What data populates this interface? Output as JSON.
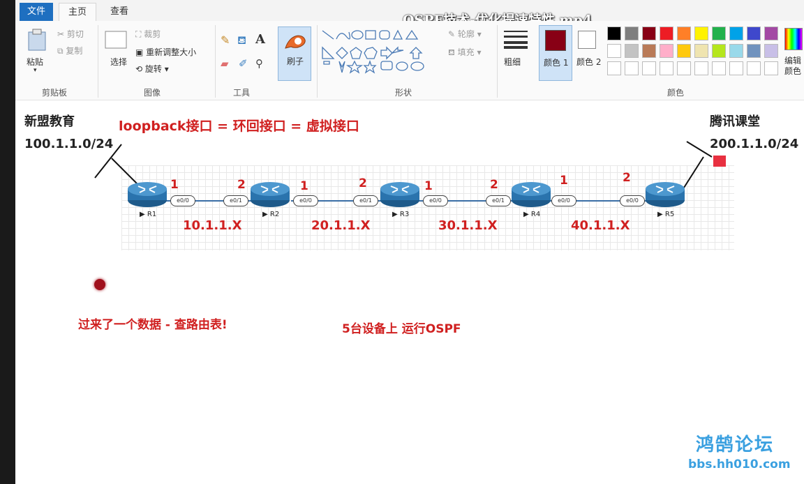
{
  "window": {
    "video_title": "OSPF技术-优化提速特性.mp4"
  },
  "tabs": [
    {
      "label": "文件"
    },
    {
      "label": "主页"
    },
    {
      "label": "查看"
    }
  ],
  "ribbon": {
    "clipboard": {
      "paste": "粘贴",
      "cut": "剪切",
      "copy": "复制",
      "group": "剪贴板"
    },
    "image": {
      "select": "选择",
      "crop": "裁剪",
      "resize": "重新调整大小",
      "rotate": "旋转",
      "group": "图像"
    },
    "tools": {
      "group": "工具"
    },
    "brush": {
      "label": "刷子"
    },
    "shapes": {
      "outline": "轮廓",
      "fill": "填充",
      "group": "形状"
    },
    "size": {
      "label": "粗细"
    },
    "color1": {
      "label": "颜色 1"
    },
    "color2": {
      "label": "颜色 2"
    },
    "colors": {
      "group": "颜色",
      "edit": "编辑颜色"
    },
    "palette": [
      "#000000",
      "#7f7f7f",
      "#880015",
      "#ed1c24",
      "#ff7f27",
      "#fff200",
      "#22b14c",
      "#00a2e8",
      "#3f48cc",
      "#a349a4",
      "#ffffff",
      "#c3c3c3",
      "#b97a57",
      "#ffaec9",
      "#ffc90e",
      "#efe4b0",
      "#b5e61d",
      "#99d9ea",
      "#7092be",
      "#c8bfe7"
    ],
    "color1_value": "#880015",
    "color2_value": "#ffffff"
  },
  "canvas": {
    "left_org": "新盟教育",
    "left_net": "100.1.1.0/24",
    "right_org": "腾讯课堂",
    "right_net": "200.1.1.0/24",
    "headline": "loopback接口 = 环回接口 = 虚拟接口",
    "routers": [
      {
        "name": "R1"
      },
      {
        "name": "R2"
      },
      {
        "name": "R3"
      },
      {
        "name": "R4"
      },
      {
        "name": "R5"
      }
    ],
    "interfaces": {
      "e00": "e0/0",
      "e01": "e0/1"
    },
    "port_numbers": {
      "one": "1",
      "two": "2"
    },
    "networks": [
      "10.1.1.X",
      "20.1.1.X",
      "30.1.1.X",
      "40.1.1.X"
    ],
    "note_left": "过来了一个数据 - 查路由表!",
    "note_right": "5台设备上 运行OSPF"
  },
  "watermark": {
    "logo_text": "鸿鹄论坛",
    "url": "bbs.hh010.com"
  }
}
